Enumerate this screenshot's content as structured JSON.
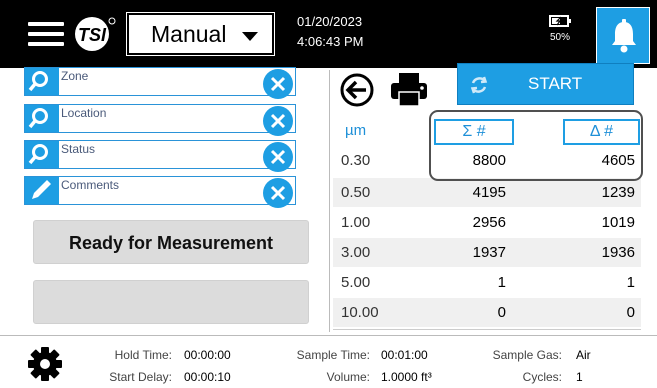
{
  "header": {
    "mode": "Manual",
    "date": "01/20/2023",
    "time": "4:06:43 PM",
    "battery_percent": "50%",
    "accent_color": "#1e9ee3"
  },
  "fields": [
    {
      "label": "Zone",
      "icon": "search-icon"
    },
    {
      "label": "Location",
      "icon": "search-icon"
    },
    {
      "label": "Status",
      "icon": "search-icon"
    },
    {
      "label": "Comments",
      "icon": "pencil-icon"
    }
  ],
  "status": {
    "message": "Ready for Measurement",
    "secondary": ""
  },
  "actions": {
    "start_label": "START"
  },
  "table": {
    "columns": [
      "µm",
      "Σ #",
      "Δ #"
    ],
    "rows": [
      [
        "0.30",
        "8800",
        "4605"
      ],
      [
        "0.50",
        "4195",
        "1239"
      ],
      [
        "1.00",
        "2956",
        "1019"
      ],
      [
        "3.00",
        "1937",
        "1936"
      ],
      [
        "5.00",
        "1",
        "1"
      ],
      [
        "10.00",
        "0",
        "0"
      ]
    ]
  },
  "footer": {
    "hold_time_label": "Hold Time:",
    "hold_time": "00:00:00",
    "start_delay_label": "Start Delay:",
    "start_delay": "00:00:10",
    "sample_time_label": "Sample Time:",
    "sample_time": "00:01:00",
    "volume_label": "Volume:",
    "volume": "1.0000 ft³",
    "sample_gas_label": "Sample Gas:",
    "sample_gas": "Air",
    "cycles_label": "Cycles:",
    "cycles": "1"
  }
}
